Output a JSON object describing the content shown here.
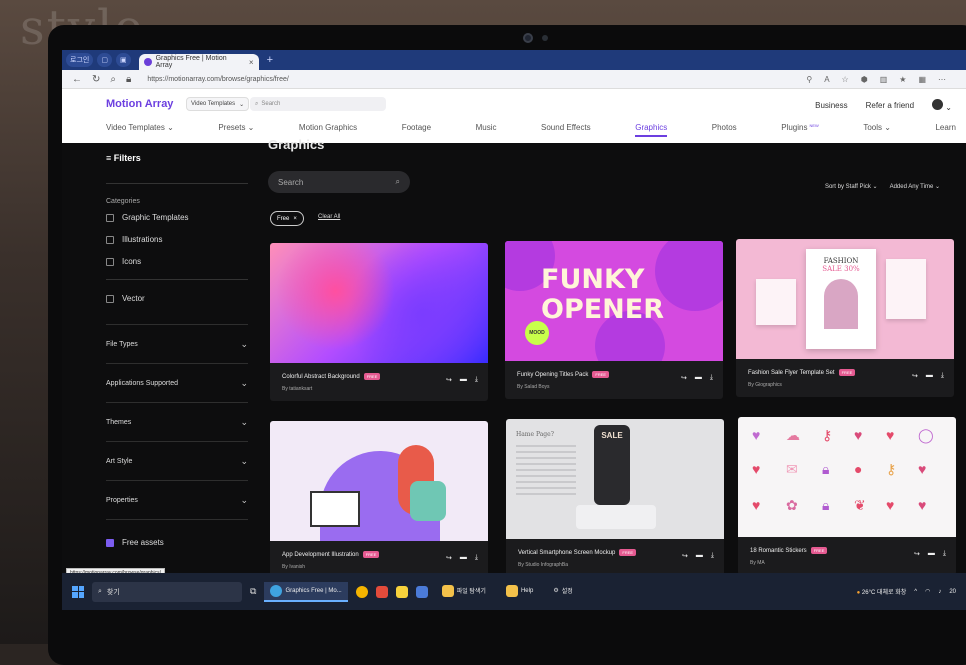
{
  "browser": {
    "tab_title": "Graphics Free | Motion Array",
    "tab_profile": "로그인",
    "url": "https://motionarray.com/browse/graphics/free/",
    "status_url": "https://motionarray.com/browse/graphics/"
  },
  "header": {
    "brand": "Motion Array",
    "type_select": "Video Templates",
    "search_placeholder": "Search",
    "business": "Business",
    "refer": "Refer a friend"
  },
  "catnav": {
    "items": [
      "Video Templates",
      "Presets",
      "Motion Graphics",
      "Footage",
      "Music",
      "Sound Effects",
      "Graphics",
      "Photos",
      "Plugins",
      "Tools",
      "Learn"
    ],
    "new_badge": "NEW"
  },
  "sidebar": {
    "filters": "Filters",
    "categories_label": "Categories",
    "categories": [
      "Graphic Templates",
      "Illustrations",
      "Icons"
    ],
    "vector": "Vector",
    "accordions": [
      "File Types",
      "Applications Supported",
      "Themes",
      "Art Style",
      "Properties"
    ],
    "free_assets": "Free assets"
  },
  "main": {
    "title": "Graphics",
    "search_placeholder": "Search",
    "sort": "Sort by Staff Pick",
    "added": "Added Any Time",
    "chip": "Free",
    "clear_all": "Clear All",
    "free_badge": "FREE",
    "cards": [
      {
        "title": "Colorful Abstract Background",
        "author": "By tatianksart"
      },
      {
        "title": "Funky Opening Titles Pack",
        "author": "By Salad Boys",
        "art_text_1": "FUNKY",
        "art_text_2": "OPENER",
        "art_badge": "MOOD"
      },
      {
        "title": "Fashion Sale Flyer Template Set",
        "author": "By Giographics",
        "art_text_1": "FASHION",
        "art_text_2": "SALE 30%"
      },
      {
        "title": "App Development Illustration",
        "author": "By Ivanish"
      },
      {
        "title": "Vertical Smartphone Screen Mockup",
        "author": "By Studio InfographBa",
        "art_text_1": "Hame Page?",
        "art_text_2": "SALE"
      },
      {
        "title": "18 Romantic Stickers",
        "author": "By MA"
      }
    ]
  },
  "taskbar": {
    "search": "찾기",
    "items": [
      "Graphics Free | Mo...",
      "파일 탐색기",
      "Help",
      "설정"
    ],
    "weather": "26°C 대체로 화창",
    "year_fragment": "20"
  },
  "room_text": "style"
}
